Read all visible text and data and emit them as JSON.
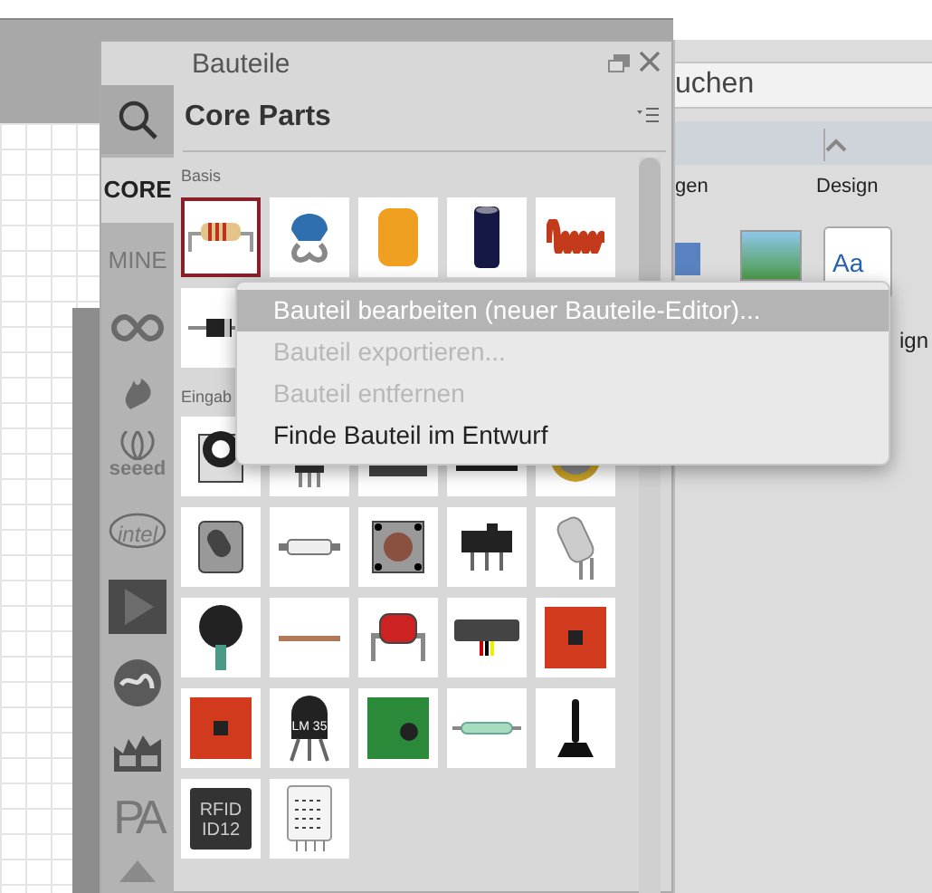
{
  "panel": {
    "title": "Bauteile",
    "bin_title": "Core Parts"
  },
  "bins": [
    {
      "kind": "text",
      "label": "CORE",
      "selected": true
    },
    {
      "kind": "text",
      "label": "MINE",
      "selected": false
    },
    {
      "kind": "arduino",
      "selected": false
    },
    {
      "kind": "flame",
      "selected": false
    },
    {
      "kind": "seeed",
      "label": "seeed",
      "selected": false
    },
    {
      "kind": "intel",
      "label": "intel",
      "selected": false
    },
    {
      "kind": "play",
      "selected": false
    },
    {
      "kind": "swirl",
      "selected": false
    },
    {
      "kind": "boards",
      "selected": false
    },
    {
      "kind": "pa",
      "label": "PA",
      "selected": false
    },
    {
      "kind": "arrow",
      "selected": false
    }
  ],
  "sections": [
    {
      "title": "Basis",
      "parts": [
        {
          "kind": "resistor",
          "selected": true
        },
        {
          "kind": "ceramic",
          "selected": false
        },
        {
          "kind": "tantalum",
          "selected": false
        },
        {
          "kind": "electrolytic",
          "selected": false
        },
        {
          "kind": "inductor",
          "selected": false
        },
        {
          "kind": "diode",
          "selected": false
        }
      ]
    },
    {
      "title": "Eingab",
      "parts": [
        {
          "kind": "pot",
          "selected": false
        },
        {
          "kind": "trimmer",
          "selected": false
        },
        {
          "kind": "module",
          "selected": false
        },
        {
          "kind": "chip",
          "selected": false
        },
        {
          "kind": "coin",
          "selected": false
        },
        {
          "kind": "rotary",
          "selected": false
        },
        {
          "kind": "smdswitch",
          "selected": false
        },
        {
          "kind": "pushbutton",
          "selected": false
        },
        {
          "kind": "slideswitch",
          "selected": false
        },
        {
          "kind": "tilt",
          "selected": false
        },
        {
          "kind": "fsr",
          "selected": false
        },
        {
          "kind": "flex",
          "selected": false
        },
        {
          "kind": "photocell",
          "selected": false
        },
        {
          "kind": "distance",
          "selected": false
        },
        {
          "kind": "redboard",
          "selected": false
        },
        {
          "kind": "redboard",
          "selected": false
        },
        {
          "kind": "lm35",
          "label": "LM 35",
          "selected": false
        },
        {
          "kind": "greenboard",
          "selected": false
        },
        {
          "kind": "reed",
          "selected": false
        },
        {
          "kind": "joystick",
          "selected": false
        },
        {
          "kind": "rfid",
          "label": "RFID ID12",
          "selected": false
        },
        {
          "kind": "dht",
          "selected": false
        }
      ]
    }
  ],
  "context_menu": [
    {
      "label": "Bauteil bearbeiten (neuer Bauteile-Editor)...",
      "selected": true,
      "disabled": false
    },
    {
      "label": "Bauteil exportieren...",
      "selected": false,
      "disabled": true
    },
    {
      "label": "Bauteil entfernen",
      "selected": false,
      "disabled": true
    },
    {
      "label": "Finde Bauteil im Entwurf",
      "selected": false,
      "disabled": false
    }
  ],
  "background_window": {
    "search_text": "uchen",
    "group_1": "gen",
    "group_2": "Design",
    "gallery_label": "ign",
    "style_sample": "Aa"
  }
}
